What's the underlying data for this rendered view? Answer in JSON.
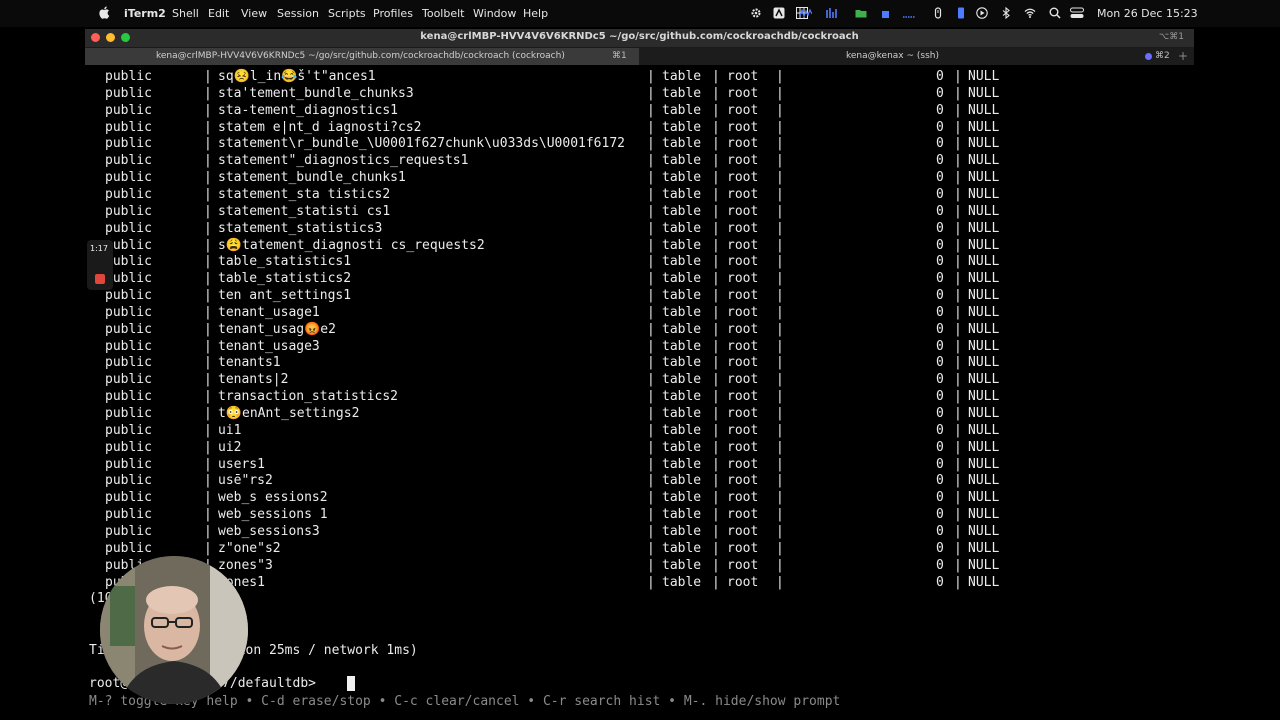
{
  "menubar": {
    "app": "iTerm2",
    "menus": [
      "Shell",
      "Edit",
      "View",
      "Session",
      "Scripts",
      "Profiles",
      "Toolbelt",
      "Window",
      "Help"
    ],
    "datetime": "Mon 26 Dec  15:23",
    "status_icons": [
      "gear-icon",
      "a-icon",
      "grid-icon",
      "wave-icon",
      "bars-icon",
      "folder-icon",
      "square-icon",
      "dots-icon",
      "pen-icon",
      "battery-icon",
      "play-icon",
      "bluetooth-icon",
      "wifi-icon",
      "search-icon",
      "control-center-icon"
    ]
  },
  "window": {
    "title": "kena@crlMBP-HVV4V6V6KRNDc5 ~/go/src/github.com/cockroachdb/cockroach",
    "title_shortcut": "⌥⌘1",
    "tabs": [
      {
        "label": "kena@crlMBP-HVV4V6V6KRNDc5 ~/go/src/github.com/cockroachdb/cockroach (cockroach)",
        "shortcut": "⌘1"
      },
      {
        "label": "kena@kenax ~ (ssh)",
        "shortcut": "⌘2"
      }
    ],
    "newtab": "+"
  },
  "terminal": {
    "rows": [
      {
        "schema": "public",
        "table": "sq😣l_in😂š't\"ances1",
        "type": "table",
        "owner": "root",
        "rows": "0",
        "locality": "NULL"
      },
      {
        "schema": "public",
        "table": "sta'tement_bundle_chunks3",
        "type": "table",
        "owner": "root",
        "rows": "0",
        "locality": "NULL"
      },
      {
        "schema": "public",
        "table": "sta-tement_diagnostics1",
        "type": "table",
        "owner": "root",
        "rows": "0",
        "locality": "NULL"
      },
      {
        "schema": "public",
        "table": "statem e|nt_d iagnosti?cs2",
        "type": "table",
        "owner": "root",
        "rows": "0",
        "locality": "NULL"
      },
      {
        "schema": "public",
        "table": "statement\\r_bundle_\\U0001f627chunk\\u033ds\\U0001f6172",
        "type": "table",
        "owner": "root",
        "rows": "0",
        "locality": "NULL"
      },
      {
        "schema": "public",
        "table": "statement\"_diagnostics_requests1",
        "type": "table",
        "owner": "root",
        "rows": "0",
        "locality": "NULL"
      },
      {
        "schema": "public",
        "table": "statement_bundle_chunks1",
        "type": "table",
        "owner": "root",
        "rows": "0",
        "locality": "NULL"
      },
      {
        "schema": "public",
        "table": "statement_sta tistics2",
        "type": "table",
        "owner": "root",
        "rows": "0",
        "locality": "NULL"
      },
      {
        "schema": "public",
        "table": "statement_statisti cs1",
        "type": "table",
        "owner": "root",
        "rows": "0",
        "locality": "NULL"
      },
      {
        "schema": "public",
        "table": "statement_statistics3",
        "type": "table",
        "owner": "root",
        "rows": "0",
        "locality": "NULL"
      },
      {
        "schema": "public",
        "table": "s😩tatement_diagnosti cs_requests2",
        "type": "table",
        "owner": "root",
        "rows": "0",
        "locality": "NULL"
      },
      {
        "schema": "public",
        "table": "table_statistics1",
        "type": "table",
        "owner": "root",
        "rows": "0",
        "locality": "NULL"
      },
      {
        "schema": "public",
        "table": "table_statistics2",
        "type": "table",
        "owner": "root",
        "rows": "0",
        "locality": "NULL"
      },
      {
        "schema": "public",
        "table": "ten ant_settings1",
        "type": "table",
        "owner": "root",
        "rows": "0",
        "locality": "NULL"
      },
      {
        "schema": "public",
        "table": "tenant_usage1",
        "type": "table",
        "owner": "root",
        "rows": "0",
        "locality": "NULL"
      },
      {
        "schema": "public",
        "table": "tenant_usag😡e2",
        "type": "table",
        "owner": "root",
        "rows": "0",
        "locality": "NULL"
      },
      {
        "schema": "public",
        "table": "tenant_usage3",
        "type": "table",
        "owner": "root",
        "rows": "0",
        "locality": "NULL"
      },
      {
        "schema": "public",
        "table": "tenants1",
        "type": "table",
        "owner": "root",
        "rows": "0",
        "locality": "NULL"
      },
      {
        "schema": "public",
        "table": "tenants|2",
        "type": "table",
        "owner": "root",
        "rows": "0",
        "locality": "NULL"
      },
      {
        "schema": "public",
        "table": "transaction_statistics2",
        "type": "table",
        "owner": "root",
        "rows": "0",
        "locality": "NULL"
      },
      {
        "schema": "public",
        "table": "t😳enAnt_settings2",
        "type": "table",
        "owner": "root",
        "rows": "0",
        "locality": "NULL"
      },
      {
        "schema": "public",
        "table": "ui1",
        "type": "table",
        "owner": "root",
        "rows": "0",
        "locality": "NULL"
      },
      {
        "schema": "public",
        "table": "ui2",
        "type": "table",
        "owner": "root",
        "rows": "0",
        "locality": "NULL"
      },
      {
        "schema": "public",
        "table": "users1",
        "type": "table",
        "owner": "root",
        "rows": "0",
        "locality": "NULL"
      },
      {
        "schema": "public",
        "table": "usē\"rs2",
        "type": "table",
        "owner": "root",
        "rows": "0",
        "locality": "NULL"
      },
      {
        "schema": "public",
        "table": "web_s essions2",
        "type": "table",
        "owner": "root",
        "rows": "0",
        "locality": "NULL"
      },
      {
        "schema": "public",
        "table": "web_sessions 1",
        "type": "table",
        "owner": "root",
        "rows": "0",
        "locality": "NULL"
      },
      {
        "schema": "public",
        "table": "web_sessions3",
        "type": "table",
        "owner": "root",
        "rows": "0",
        "locality": "NULL"
      },
      {
        "schema": "public",
        "table": "z\"one\"s2",
        "type": "table",
        "owner": "root",
        "rows": "0",
        "locality": "NULL"
      },
      {
        "schema": "public",
        "table": "zones\"3",
        "type": "table",
        "owner": "root",
        "rows": "0",
        "locality": "NULL"
      },
      {
        "schema": "public",
        "table": "zones1",
        "type": "table",
        "owner": "root",
        "rows": "0",
        "locality": "NULL"
      }
    ],
    "separator": "|",
    "row_count": "(10",
    "time_line": "Ti            xecution 25ms / network 1ms)",
    "prompt": "root@         5257/defaultdb> ",
    "help_line": "M-? toggle key help • C-d erase/stop • C-c clear/cancel • C-r search hist • M-. hide/show prompt"
  },
  "recording": {
    "time": "1:17"
  },
  "colors": {
    "close": "#ff5f57",
    "minimize": "#febc2e",
    "zoom": "#28c840",
    "record": "#e0463a",
    "tab_dot": "#6d6dff"
  }
}
